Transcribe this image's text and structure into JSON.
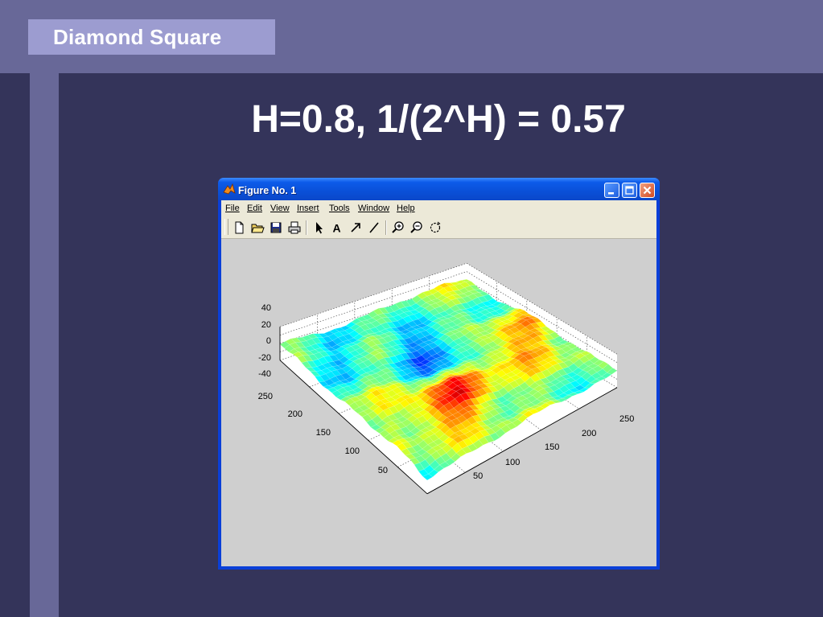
{
  "slide": {
    "tag": "Diamond Square",
    "headline": "H=0.8, 1/(2^H) = 0.57"
  },
  "window": {
    "title": "Figure No. 1",
    "menu": [
      "File",
      "Edit",
      "View",
      "Insert",
      "Tools",
      "Window",
      "Help"
    ],
    "toolbar_icons": [
      "new-file-icon",
      "open-folder-icon",
      "save-icon",
      "print-icon",
      "select-arrow-icon",
      "insert-text-icon",
      "insert-arrow-icon",
      "insert-line-icon",
      "zoom-in-icon",
      "zoom-out-icon",
      "rotate-3d-icon"
    ]
  },
  "plot": {
    "type": "3d-surface",
    "colormap": "jet",
    "grid": true,
    "z_ticks": [
      "40",
      "20",
      "0",
      "-20",
      "-40"
    ],
    "y_ticks": [
      "250",
      "200",
      "150",
      "100",
      "50"
    ],
    "x_ticks": [
      "50",
      "100",
      "150",
      "200",
      "250"
    ],
    "z_range": [
      -40,
      40
    ],
    "x_range": [
      0,
      257
    ],
    "y_range": [
      0,
      257
    ]
  }
}
